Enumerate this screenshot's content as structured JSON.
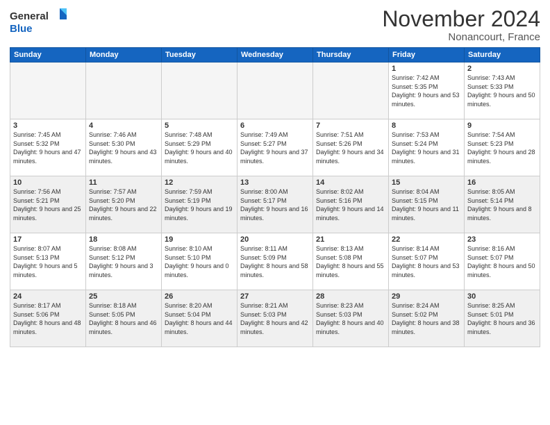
{
  "header": {
    "logo_general": "General",
    "logo_blue": "Blue",
    "month_title": "November 2024",
    "subtitle": "Nonancourt, France"
  },
  "weekdays": [
    "Sunday",
    "Monday",
    "Tuesday",
    "Wednesday",
    "Thursday",
    "Friday",
    "Saturday"
  ],
  "weeks": [
    [
      {
        "day": "",
        "empty": true
      },
      {
        "day": "",
        "empty": true
      },
      {
        "day": "",
        "empty": true
      },
      {
        "day": "",
        "empty": true
      },
      {
        "day": "",
        "empty": true
      },
      {
        "day": "1",
        "info": "Sunrise: 7:42 AM\nSunset: 5:35 PM\nDaylight: 9 hours\nand 53 minutes."
      },
      {
        "day": "2",
        "info": "Sunrise: 7:43 AM\nSunset: 5:33 PM\nDaylight: 9 hours\nand 50 minutes."
      }
    ],
    [
      {
        "day": "3",
        "info": "Sunrise: 7:45 AM\nSunset: 5:32 PM\nDaylight: 9 hours\nand 47 minutes."
      },
      {
        "day": "4",
        "info": "Sunrise: 7:46 AM\nSunset: 5:30 PM\nDaylight: 9 hours\nand 43 minutes."
      },
      {
        "day": "5",
        "info": "Sunrise: 7:48 AM\nSunset: 5:29 PM\nDaylight: 9 hours\nand 40 minutes."
      },
      {
        "day": "6",
        "info": "Sunrise: 7:49 AM\nSunset: 5:27 PM\nDaylight: 9 hours\nand 37 minutes."
      },
      {
        "day": "7",
        "info": "Sunrise: 7:51 AM\nSunset: 5:26 PM\nDaylight: 9 hours\nand 34 minutes."
      },
      {
        "day": "8",
        "info": "Sunrise: 7:53 AM\nSunset: 5:24 PM\nDaylight: 9 hours\nand 31 minutes."
      },
      {
        "day": "9",
        "info": "Sunrise: 7:54 AM\nSunset: 5:23 PM\nDaylight: 9 hours\nand 28 minutes."
      }
    ],
    [
      {
        "day": "10",
        "info": "Sunrise: 7:56 AM\nSunset: 5:21 PM\nDaylight: 9 hours\nand 25 minutes."
      },
      {
        "day": "11",
        "info": "Sunrise: 7:57 AM\nSunset: 5:20 PM\nDaylight: 9 hours\nand 22 minutes."
      },
      {
        "day": "12",
        "info": "Sunrise: 7:59 AM\nSunset: 5:19 PM\nDaylight: 9 hours\nand 19 minutes."
      },
      {
        "day": "13",
        "info": "Sunrise: 8:00 AM\nSunset: 5:17 PM\nDaylight: 9 hours\nand 16 minutes."
      },
      {
        "day": "14",
        "info": "Sunrise: 8:02 AM\nSunset: 5:16 PM\nDaylight: 9 hours\nand 14 minutes."
      },
      {
        "day": "15",
        "info": "Sunrise: 8:04 AM\nSunset: 5:15 PM\nDaylight: 9 hours\nand 11 minutes."
      },
      {
        "day": "16",
        "info": "Sunrise: 8:05 AM\nSunset: 5:14 PM\nDaylight: 9 hours\nand 8 minutes."
      }
    ],
    [
      {
        "day": "17",
        "info": "Sunrise: 8:07 AM\nSunset: 5:13 PM\nDaylight: 9 hours\nand 5 minutes."
      },
      {
        "day": "18",
        "info": "Sunrise: 8:08 AM\nSunset: 5:12 PM\nDaylight: 9 hours\nand 3 minutes."
      },
      {
        "day": "19",
        "info": "Sunrise: 8:10 AM\nSunset: 5:10 PM\nDaylight: 9 hours\nand 0 minutes."
      },
      {
        "day": "20",
        "info": "Sunrise: 8:11 AM\nSunset: 5:09 PM\nDaylight: 8 hours\nand 58 minutes."
      },
      {
        "day": "21",
        "info": "Sunrise: 8:13 AM\nSunset: 5:08 PM\nDaylight: 8 hours\nand 55 minutes."
      },
      {
        "day": "22",
        "info": "Sunrise: 8:14 AM\nSunset: 5:07 PM\nDaylight: 8 hours\nand 53 minutes."
      },
      {
        "day": "23",
        "info": "Sunrise: 8:16 AM\nSunset: 5:07 PM\nDaylight: 8 hours\nand 50 minutes."
      }
    ],
    [
      {
        "day": "24",
        "info": "Sunrise: 8:17 AM\nSunset: 5:06 PM\nDaylight: 8 hours\nand 48 minutes."
      },
      {
        "day": "25",
        "info": "Sunrise: 8:18 AM\nSunset: 5:05 PM\nDaylight: 8 hours\nand 46 minutes."
      },
      {
        "day": "26",
        "info": "Sunrise: 8:20 AM\nSunset: 5:04 PM\nDaylight: 8 hours\nand 44 minutes."
      },
      {
        "day": "27",
        "info": "Sunrise: 8:21 AM\nSunset: 5:03 PM\nDaylight: 8 hours\nand 42 minutes."
      },
      {
        "day": "28",
        "info": "Sunrise: 8:23 AM\nSunset: 5:03 PM\nDaylight: 8 hours\nand 40 minutes."
      },
      {
        "day": "29",
        "info": "Sunrise: 8:24 AM\nSunset: 5:02 PM\nDaylight: 8 hours\nand 38 minutes."
      },
      {
        "day": "30",
        "info": "Sunrise: 8:25 AM\nSunset: 5:01 PM\nDaylight: 8 hours\nand 36 minutes."
      }
    ]
  ]
}
